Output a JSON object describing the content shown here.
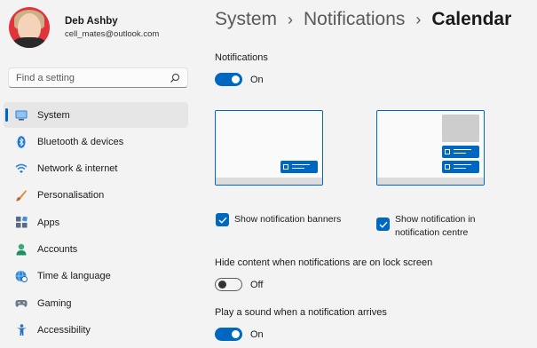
{
  "profile": {
    "name": "Deb Ashby",
    "email": "cell_mates@outlook.com"
  },
  "search": {
    "placeholder": "Find a setting"
  },
  "nav": [
    {
      "label": "System",
      "icon": "monitor-icon",
      "active": true
    },
    {
      "label": "Bluetooth & devices",
      "icon": "bluetooth-icon"
    },
    {
      "label": "Network & internet",
      "icon": "wifi-icon"
    },
    {
      "label": "Personalisation",
      "icon": "brush-icon"
    },
    {
      "label": "Apps",
      "icon": "apps-icon"
    },
    {
      "label": "Accounts",
      "icon": "person-icon"
    },
    {
      "label": "Time & language",
      "icon": "globe-clock-icon"
    },
    {
      "label": "Gaming",
      "icon": "gamepad-icon"
    },
    {
      "label": "Accessibility",
      "icon": "accessibility-icon"
    }
  ],
  "breadcrumb": {
    "items": [
      "System",
      "Notifications",
      "Calendar"
    ]
  },
  "notifications": {
    "label": "Notifications",
    "state": "On"
  },
  "banners": {
    "label": "Show notification banners",
    "checked": true
  },
  "centre": {
    "label": "Show notification in notification centre",
    "checked": true
  },
  "lock_screen": {
    "label": "Hide content when notifications are on lock screen",
    "state": "Off"
  },
  "sound": {
    "label": "Play a sound when a notification arrives",
    "state": "On"
  },
  "colors": {
    "accent": "#0067c0",
    "background": "#f3f3f3"
  }
}
